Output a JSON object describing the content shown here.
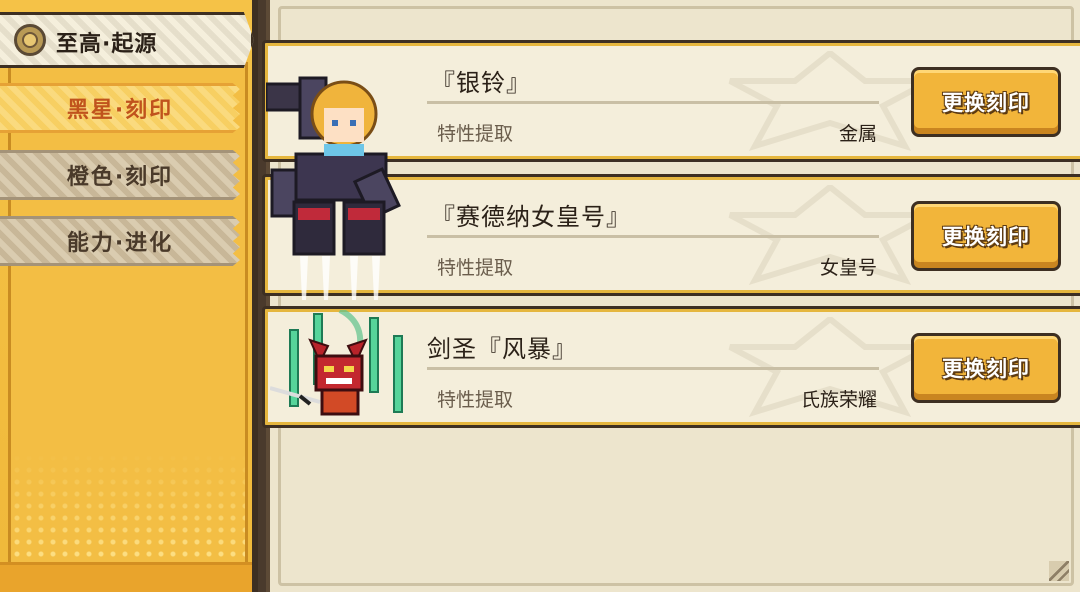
{
  "sidebar": {
    "category": {
      "title": "至高·起源",
      "icon": "engraving-medal-icon"
    },
    "items": [
      {
        "label": "黑星·刻印",
        "active": true
      },
      {
        "label": "橙色·刻印",
        "active": false
      },
      {
        "label": "能力·进化",
        "active": false
      }
    ]
  },
  "cards": [
    {
      "title": "『银铃』",
      "label": "特性提取",
      "trait": "金属",
      "button": "更换刻印"
    },
    {
      "title": "『赛德纳女皇号』",
      "label": "特性提取",
      "trait": "女皇号",
      "button": "更换刻印"
    },
    {
      "title": "剑圣『风暴』",
      "label": "特性提取",
      "trait": "氏族荣耀",
      "button": "更换刻印"
    }
  ],
  "colors": {
    "accent_gold": "#f2b53a",
    "active_text": "#c0531d",
    "panel_bg": "#ede5cd"
  }
}
